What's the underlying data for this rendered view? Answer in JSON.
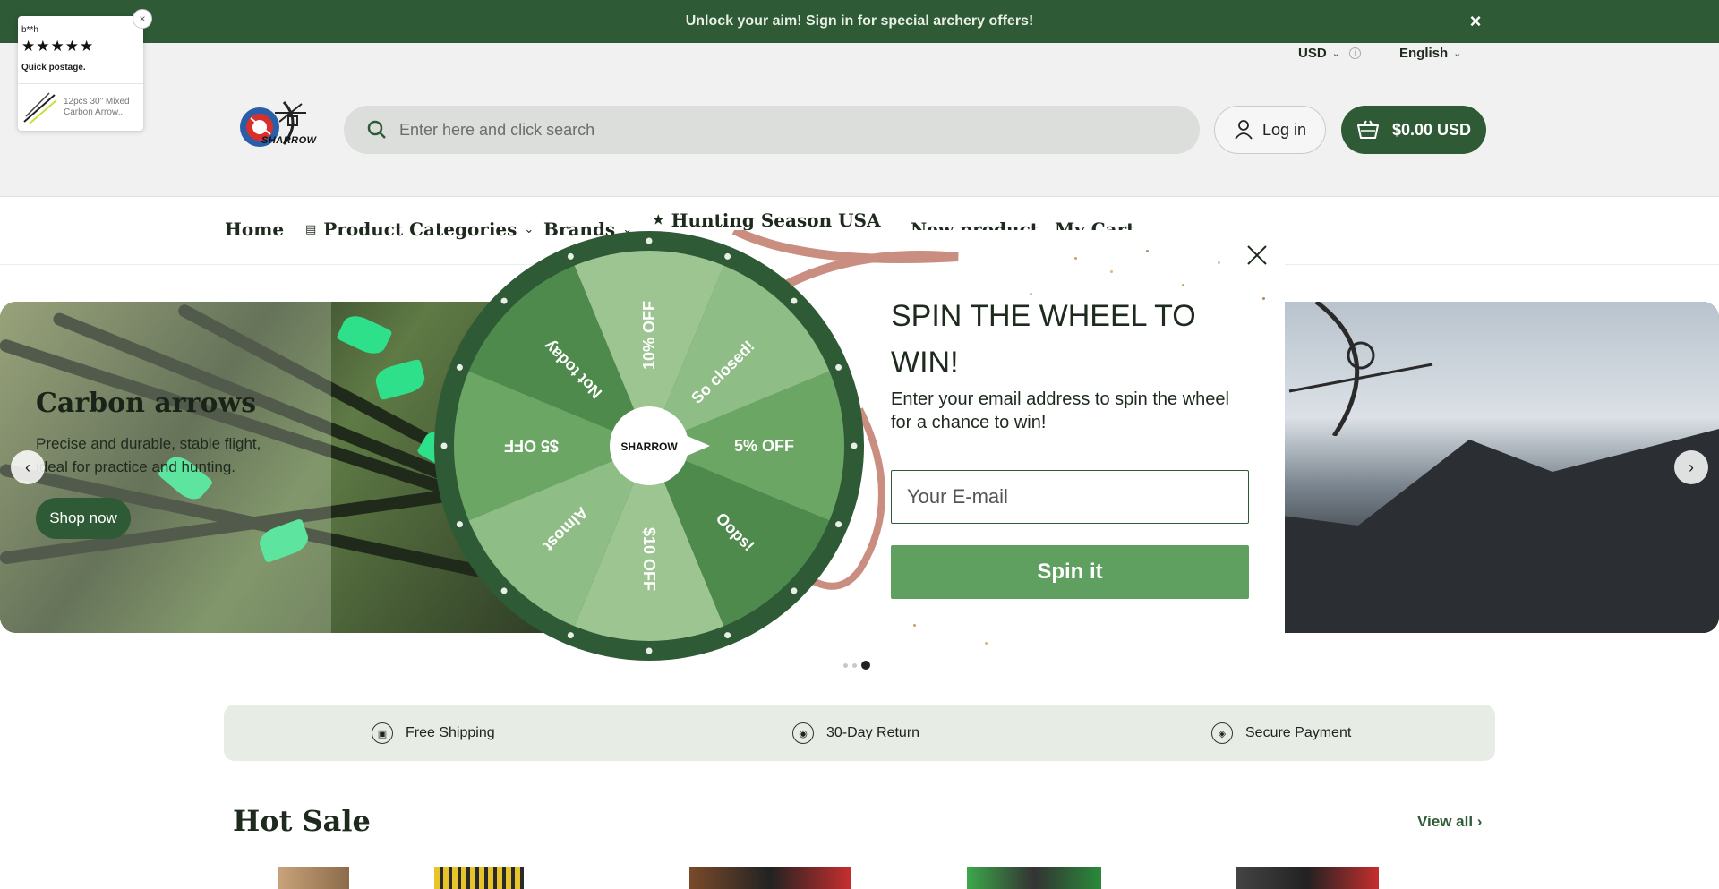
{
  "announcement": {
    "text": "Unlock your aim! Sign in for special archery offers!",
    "close_icon": "×"
  },
  "utility": {
    "currency": "USD",
    "language": "English"
  },
  "header": {
    "logo_text": "SHARROW",
    "search_placeholder": "Enter here and click search",
    "login_label": "Log in",
    "cart_label": "$0.00 USD"
  },
  "nav": {
    "home": "Home",
    "categories": "Product Categories",
    "brands": "Brands",
    "hunting": "Hunting Season USA",
    "new_product": "New product",
    "my_cart": "My Cart"
  },
  "hero": {
    "title": "Carbon arrows",
    "description": "Precise and durable, stable flight, ideal for practice and hunting.",
    "cta": "Shop now"
  },
  "features": [
    {
      "label": "Free Shipping",
      "icon": "truck-icon"
    },
    {
      "label": "30-Day Return",
      "icon": "badge-icon"
    },
    {
      "label": "Secure Payment",
      "icon": "shield-icon"
    }
  ],
  "hot_sale": {
    "title": "Hot Sale",
    "view_all": "View all"
  },
  "review": {
    "name": "b**h",
    "stars": "★★★★★",
    "text": "Quick postage.",
    "product": "12pcs 30\" Mixed Carbon Arrow...",
    "close": "×"
  },
  "spin_modal": {
    "title": "SPIN THE WHEEL TO WIN!",
    "description": "Enter your email address to spin the wheel for a chance to win!",
    "email_placeholder": "Your E-mail",
    "button_label": "Spin it",
    "hub_text": "SHARROW",
    "segments": [
      "5% OFF",
      "So closed!",
      "10% OFF",
      "Not today",
      "$5 OFF",
      "Almost",
      "$10 OFF",
      "Oops!"
    ]
  },
  "colors": {
    "brand_green": "#2f5a36",
    "button_green": "#5f9f5f",
    "wheel_light": "#8ebd86",
    "wheel_mid": "#6ca665",
    "wheel_dark": "#4f8a4d",
    "wheel_rim": "#2f5a36"
  }
}
